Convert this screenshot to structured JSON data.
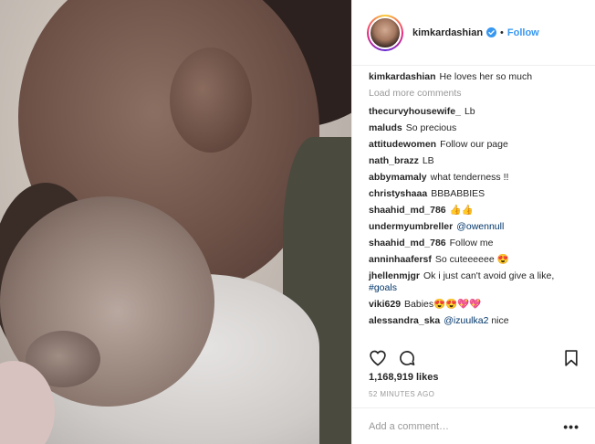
{
  "colors": {
    "link_blue": "#3897f0",
    "muted_grey": "#999999",
    "text_dark": "#262626",
    "mention_blue": "#003569"
  },
  "photo": {
    "subject": "image"
  },
  "header": {
    "username": "kimkardashian",
    "verified_icon": "verified-badge-icon",
    "separator": "•",
    "follow_label": "Follow"
  },
  "caption": {
    "user": "kimkardashian",
    "text": "He loves her so much"
  },
  "load_more_label": "Load more comments",
  "comments": [
    {
      "user": "thecurvyhousewife_",
      "text": "Lb"
    },
    {
      "user": "maluds",
      "text": "So precious"
    },
    {
      "user": "attitudewomen",
      "text": "Follow our page"
    },
    {
      "user": "nath_brazz",
      "text": "LB"
    },
    {
      "user": "abbymamaly",
      "text": "what tenderness !!"
    },
    {
      "user": "christyshaaa",
      "text": "BBBABBIES"
    },
    {
      "user": "shaahid_md_786",
      "text": "👍👍"
    },
    {
      "user": "undermyumbreller",
      "text": "@owennull"
    },
    {
      "user": "shaahid_md_786",
      "text": "Follow me"
    },
    {
      "user": "anninhaafersf",
      "text": "So cuteeeeee 😍"
    },
    {
      "user": "jhellenmjgr",
      "text": "Ok i just can't avoid give a like,",
      "text2": "#goals"
    },
    {
      "user": "viki629",
      "text": "Babies😍😍💖💖"
    },
    {
      "user": "alessandra_ska",
      "text": "@izuulka2",
      "text_after": " nice"
    }
  ],
  "actions": {
    "like_icon": "heart-icon",
    "comment_icon": "comment-bubble-icon",
    "save_icon": "bookmark-icon"
  },
  "likes_text": "1,168,919 likes",
  "timestamp": "52 MINUTES AGO",
  "add_comment": {
    "placeholder": "Add a comment…",
    "more_label": "•••"
  }
}
